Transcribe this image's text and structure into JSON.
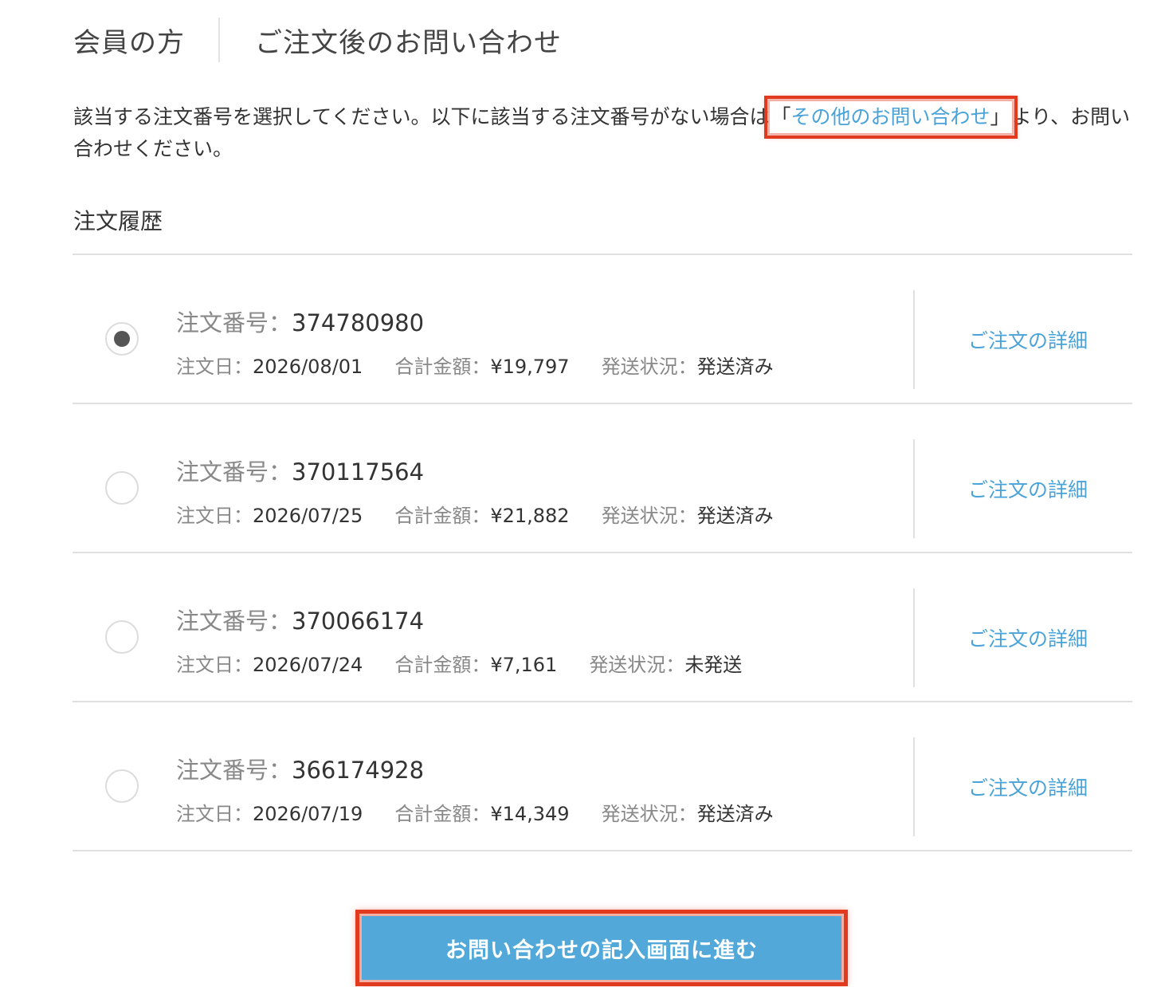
{
  "header": {
    "title": "会員の方",
    "subtitle": "ご注文後のお問い合わせ"
  },
  "intro": {
    "text_before": "該当する注文番号を選択してください。以下に該当する注文番号がない場合は",
    "bracket_open": "「",
    "link_label": "その他のお問い合わせ",
    "bracket_close": "」",
    "text_after": "より、お問い合わせください。"
  },
  "section_title": "注文履歴",
  "labels": {
    "order_no": "注文番号：",
    "order_date": "注文日：",
    "total": "合計金額：",
    "shipping": "発送状況：",
    "detail_link": "ご注文の詳細"
  },
  "orders": [
    {
      "order_no": "374780980",
      "date": "2026/08/01",
      "total": "¥19,797",
      "status": "発送済み",
      "selected": true
    },
    {
      "order_no": "370117564",
      "date": "2026/07/25",
      "total": "¥21,882",
      "status": "発送済み",
      "selected": false
    },
    {
      "order_no": "370066174",
      "date": "2026/07/24",
      "total": "¥7,161",
      "status": "未発送",
      "selected": false
    },
    {
      "order_no": "366174928",
      "date": "2026/07/19",
      "total": "¥14,349",
      "status": "発送済み",
      "selected": false
    }
  ],
  "submit_label": "お問い合わせの記入画面に進む",
  "colors": {
    "link": "#4aa3d8",
    "button": "#52a8d9",
    "highlight": "#e23a1f"
  }
}
